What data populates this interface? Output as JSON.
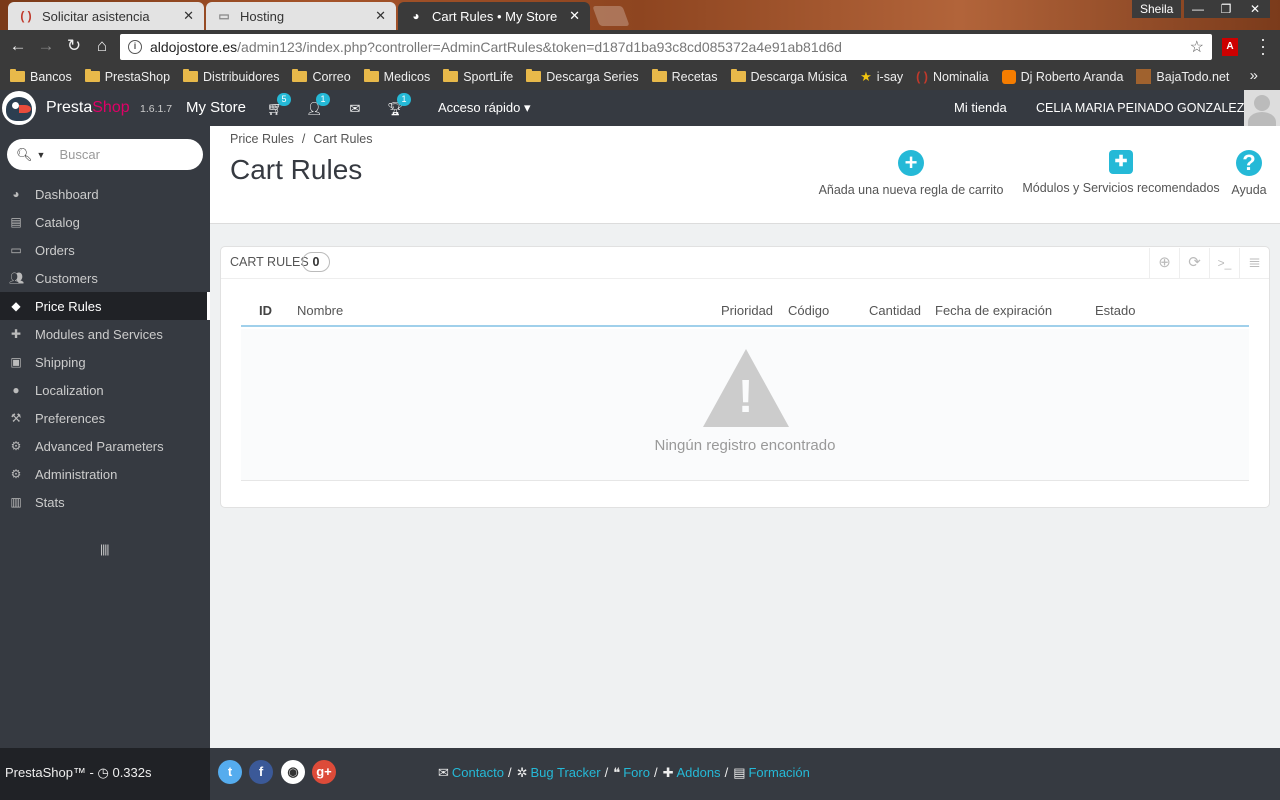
{
  "browser": {
    "tabs": [
      {
        "title": "Solicitar asistencia",
        "icon": "( )"
      },
      {
        "title": "Hosting",
        "icon": ""
      },
      {
        "title": "Cart Rules • My Store",
        "icon": ""
      }
    ],
    "profile_user": "Sheila",
    "url_domain": "aldojostore.es",
    "url_path": "/admin123/index.php?controller=AdminCartRules&token=d187d1ba93c8cd085372a4e91ab81d6d",
    "bookmarks": [
      "Bancos",
      "PrestaShop",
      "Distribuidores",
      "Correo",
      "Medicos",
      "SportLife",
      "Descarga Series",
      "Recetas",
      "Descarga Música",
      "i-say",
      "Nominalia",
      "Dj Roberto Aranda",
      "BajaTodo.net"
    ]
  },
  "header": {
    "brand_a": "Presta",
    "brand_b": "Shop",
    "version": "1.6.1.7",
    "store_name": "My Store",
    "cart_badge": "5",
    "customers_badge": "1",
    "trophy_badge": "1",
    "quick_access": "Acceso rápido",
    "my_shop": "Mi tienda",
    "employee": "CELIA MARIA PEINADO GONZALEZ"
  },
  "sidebar": {
    "search_placeholder": "Buscar",
    "items": [
      {
        "label": "Dashboard",
        "icon": "dashboard-icon"
      },
      {
        "label": "Catalog",
        "icon": "book-icon"
      },
      {
        "label": "Orders",
        "icon": "credit-card-icon"
      },
      {
        "label": "Customers",
        "icon": "users-icon"
      },
      {
        "label": "Price Rules",
        "icon": "tags-icon",
        "active": true
      },
      {
        "label": "Modules and Services",
        "icon": "puzzle-icon"
      },
      {
        "label": "Shipping",
        "icon": "truck-icon"
      },
      {
        "label": "Localization",
        "icon": "globe-icon"
      },
      {
        "label": "Preferences",
        "icon": "wrench-icon"
      },
      {
        "label": "Advanced Parameters",
        "icon": "cogs-icon"
      },
      {
        "label": "Administration",
        "icon": "cog-icon"
      },
      {
        "label": "Stats",
        "icon": "bar-chart-icon"
      }
    ]
  },
  "breadcrumb": {
    "parent": "Price Rules",
    "current": "Cart Rules"
  },
  "page_title": "Cart Rules",
  "toolbar": {
    "add_label": "Añada una nueva regla de carrito",
    "modules_label": "Módulos y Servicios recomendados",
    "help_label": "Ayuda"
  },
  "panel": {
    "title": "Cart Rules",
    "count": "0",
    "columns": [
      "ID",
      "Nombre",
      "Prioridad",
      "Código",
      "Cantidad",
      "Fecha de expiración",
      "Estado"
    ],
    "empty_text": "Ningún registro encontrado"
  },
  "footer": {
    "version_text": "PrestaShop™ - ",
    "load_time": "0.332s",
    "links": [
      "Contacto",
      "Bug Tracker",
      "Foro",
      "Addons",
      "Formación"
    ]
  },
  "colors": {
    "accent": "#25b9d7",
    "header_bg": "#363a41",
    "brand_pink": "#df0067"
  }
}
